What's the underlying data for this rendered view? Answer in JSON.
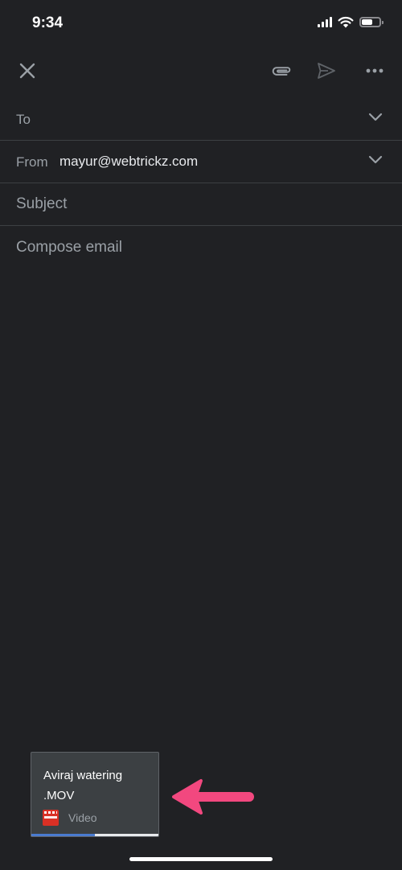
{
  "status": {
    "time": "9:34",
    "battery_level": 0.55,
    "signal_bars": 4,
    "icons": [
      "cellular-signal-icon",
      "wifi-icon",
      "battery-icon"
    ]
  },
  "toolbar": {
    "close_icon": "close-icon",
    "attach_icon": "paperclip-icon",
    "send_icon": "send-icon",
    "more_icon": "more-horizontal-icon"
  },
  "to": {
    "label": "To"
  },
  "from": {
    "label": "From",
    "value": "mayur@webtrickz.com"
  },
  "subject": {
    "placeholder": "Subject"
  },
  "compose": {
    "placeholder": "Compose email"
  },
  "attachment": {
    "filename": "Aviraj watering .MOV",
    "type_label": "Video",
    "upload_progress": 0.5,
    "icon": "video-clapperboard-icon",
    "icon_color": "#d93025"
  },
  "annotation": {
    "arrow_color": "#f2487f",
    "icon": "arrow-left-icon"
  },
  "colors": {
    "background": "#202124",
    "divider": "#3c4043",
    "muted_text": "#9aa0a6",
    "progress": "#4a7bd0"
  }
}
